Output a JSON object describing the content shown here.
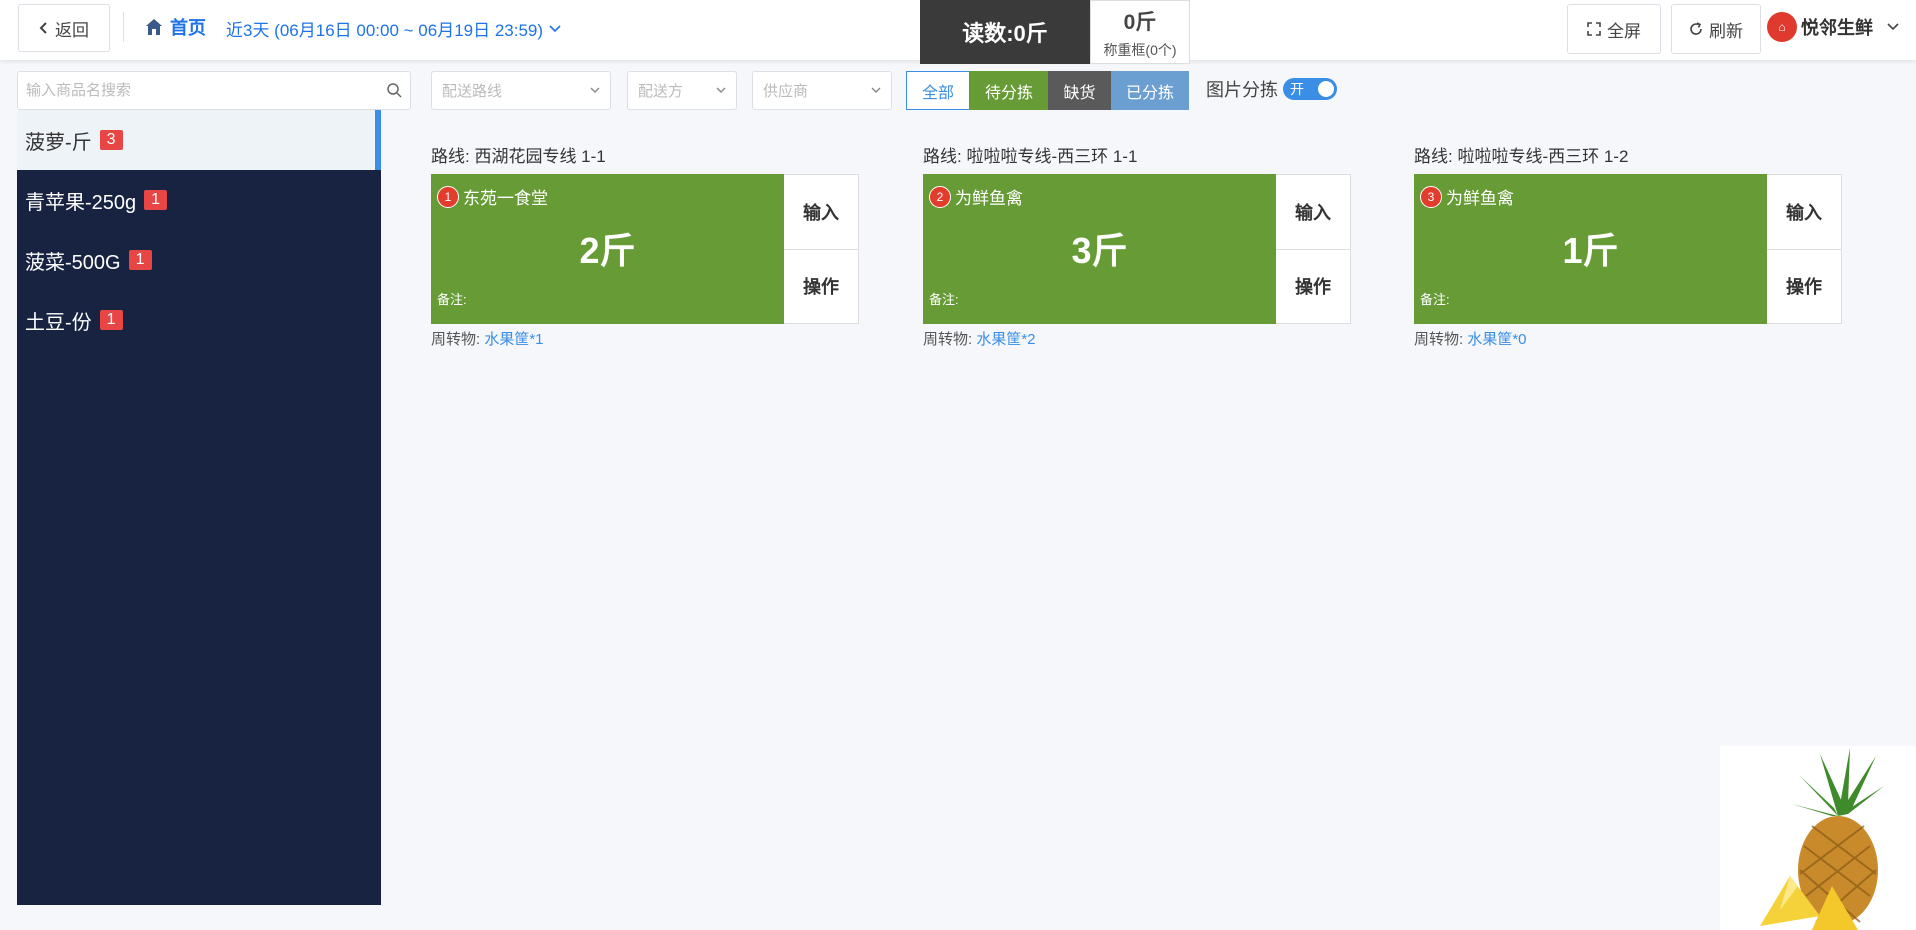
{
  "header": {
    "back_label": "返回",
    "home_label": "首页",
    "date_range": "近3天 (06月16日 00:00 ~ 06月19日 23:59)",
    "reading": "读数:0斤",
    "weight": "0斤",
    "weigh_basket": "称重框(0个)",
    "fullscreen_label": "全屏",
    "refresh_label": "刷新",
    "brand": "悦邻生鲜"
  },
  "search": {
    "placeholder": "输入商品名搜索"
  },
  "sidebar": {
    "items": [
      {
        "label": "菠萝-斤",
        "count": "3"
      },
      {
        "label": "青苹果-250g",
        "count": "1"
      },
      {
        "label": "菠菜-500G",
        "count": "1"
      },
      {
        "label": "土豆-份",
        "count": "1"
      }
    ]
  },
  "filters": {
    "route_placeholder": "配送路线",
    "deliverer_placeholder": "配送方",
    "supplier_placeholder": "供应商",
    "tabs": [
      "全部",
      "待分拣",
      "缺货",
      "已分拣"
    ],
    "image_sort_label": "图片分拣",
    "toggle_label": "开"
  },
  "cards": [
    {
      "route": "路线:  西湖花园专线 1-1",
      "num": "1",
      "shop": "东苑一食堂",
      "qty": "2斤",
      "note": "备注:",
      "input": "输入",
      "operate": "操作",
      "turnover_label": "周转物:",
      "turnover_value": "水果筐*1"
    },
    {
      "route": "路线:  啦啦啦专线-西三环 1-1",
      "num": "2",
      "shop": "为鲜鱼禽",
      "qty": "3斤",
      "note": "备注:",
      "input": "输入",
      "operate": "操作",
      "turnover_label": "周转物:",
      "turnover_value": "水果筐*2"
    },
    {
      "route": "路线:  啦啦啦专线-西三环 1-2",
      "num": "3",
      "shop": "为鲜鱼禽",
      "qty": "1斤",
      "note": "备注:",
      "input": "输入",
      "operate": "操作",
      "turnover_label": "周转物:",
      "turnover_value": "水果筐*0"
    }
  ],
  "colors": {
    "accent": "#3a8ee6",
    "sidebar": "#172341",
    "card_green": "#669b35",
    "badge": "#e84545"
  },
  "icons": {
    "back": "chevron-left-icon",
    "home": "home-icon",
    "dropdown": "chevron-down-icon",
    "fullscreen": "expand-icon",
    "refresh": "refresh-icon",
    "search": "search-icon",
    "product": "pineapple-image"
  }
}
